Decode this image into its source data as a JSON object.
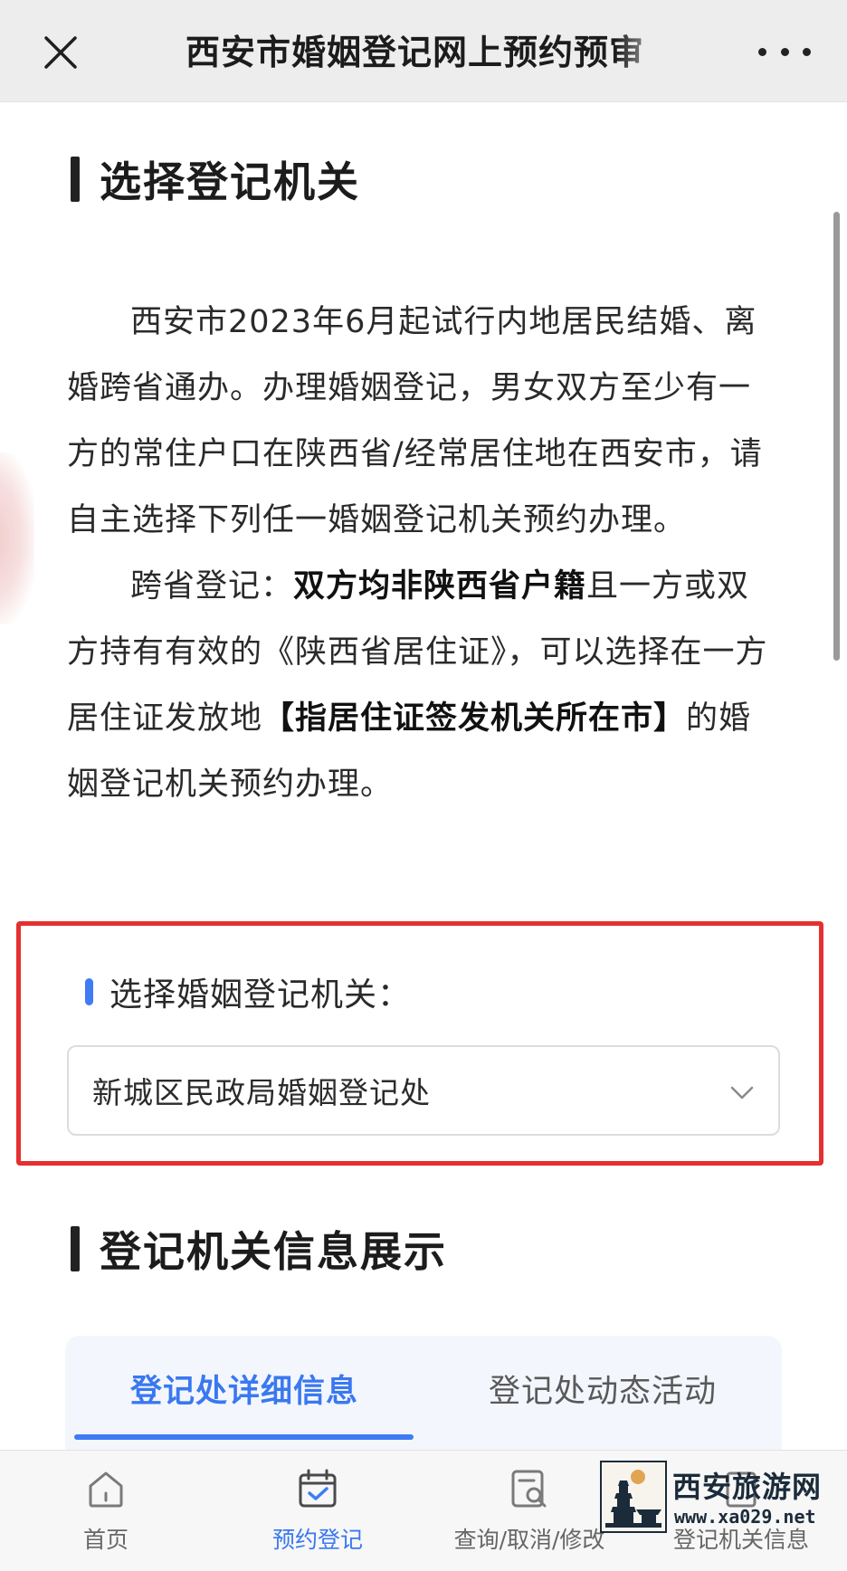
{
  "topbar": {
    "title": "西安市婚姻登记网上预约预审",
    "close_icon": "close-icon",
    "more_icon": "more-dots-icon"
  },
  "section1": {
    "heading": "选择登记机关"
  },
  "intro": {
    "p1": "西安市2023年6月起试行内地居民结婚、离婚跨省通办。办理婚姻登记，男女双方至少有一方的常住户口在陕西省/经常居住地在西安市，请自主选择下列任一婚姻登记机关预约办理。",
    "p2_prefix": "跨省登记：",
    "p2_bold1": "双方均非陕西省户籍",
    "p2_mid": "且一方或双方持有有效的《陕西省居住证》，可以选择在一方居住证发放地",
    "p2_bold2": "【指居住证签发机关所在市】",
    "p2_suffix": "的婚姻登记机关预约办理。"
  },
  "selector": {
    "label": "选择婚姻登记机关：",
    "selected_value": "新城区民政局婚姻登记处",
    "chevron_icon": "chevron-down-icon"
  },
  "section2": {
    "heading": "登记机关信息展示"
  },
  "tabs": [
    {
      "label": "登记处详细信息",
      "active": true
    },
    {
      "label": "登记处动态活动",
      "active": false
    }
  ],
  "bottom_nav": [
    {
      "label": "首页",
      "icon": "home-icon",
      "active": false
    },
    {
      "label": "预约登记",
      "icon": "calendar-check-icon",
      "active": true
    },
    {
      "label": "查询/取消/修改",
      "icon": "search-document-icon",
      "active": false
    },
    {
      "label": "登记机关信息",
      "icon": "building-icon",
      "active": false
    }
  ],
  "watermark": {
    "title": "西安旅游网",
    "url": "www.xa029.net"
  },
  "colors": {
    "accent": "#3f7cf4",
    "highlight_border": "#e53030",
    "topbar_bg": "#ededed"
  }
}
